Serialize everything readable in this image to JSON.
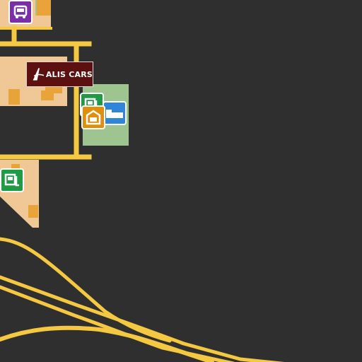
{
  "map": {
    "background_color": "#2f2f2f",
    "road_color": "#f5c842",
    "building_color": "#efc895",
    "park_color": "#9ec48f",
    "water_color": "#3c8ad8"
  },
  "business_sign": {
    "name": "ALIS CARS",
    "icon": "alis-cars-logo"
  },
  "markers": [
    {
      "id": "truck-marker",
      "icon": "truck-icon",
      "color": "#7a2fa8"
    },
    {
      "id": "car-dealer-marker",
      "icon": "car-dealer-icon",
      "color": "#1f9a45"
    },
    {
      "id": "garage-marker",
      "icon": "garage-icon",
      "color": "#e08e0b"
    },
    {
      "id": "parking-marker",
      "icon": "parking-icon",
      "color": "#2f86d8"
    },
    {
      "id": "car-dealer-marker-west",
      "icon": "car-dealer-icon",
      "color": "#1f9a45"
    }
  ]
}
